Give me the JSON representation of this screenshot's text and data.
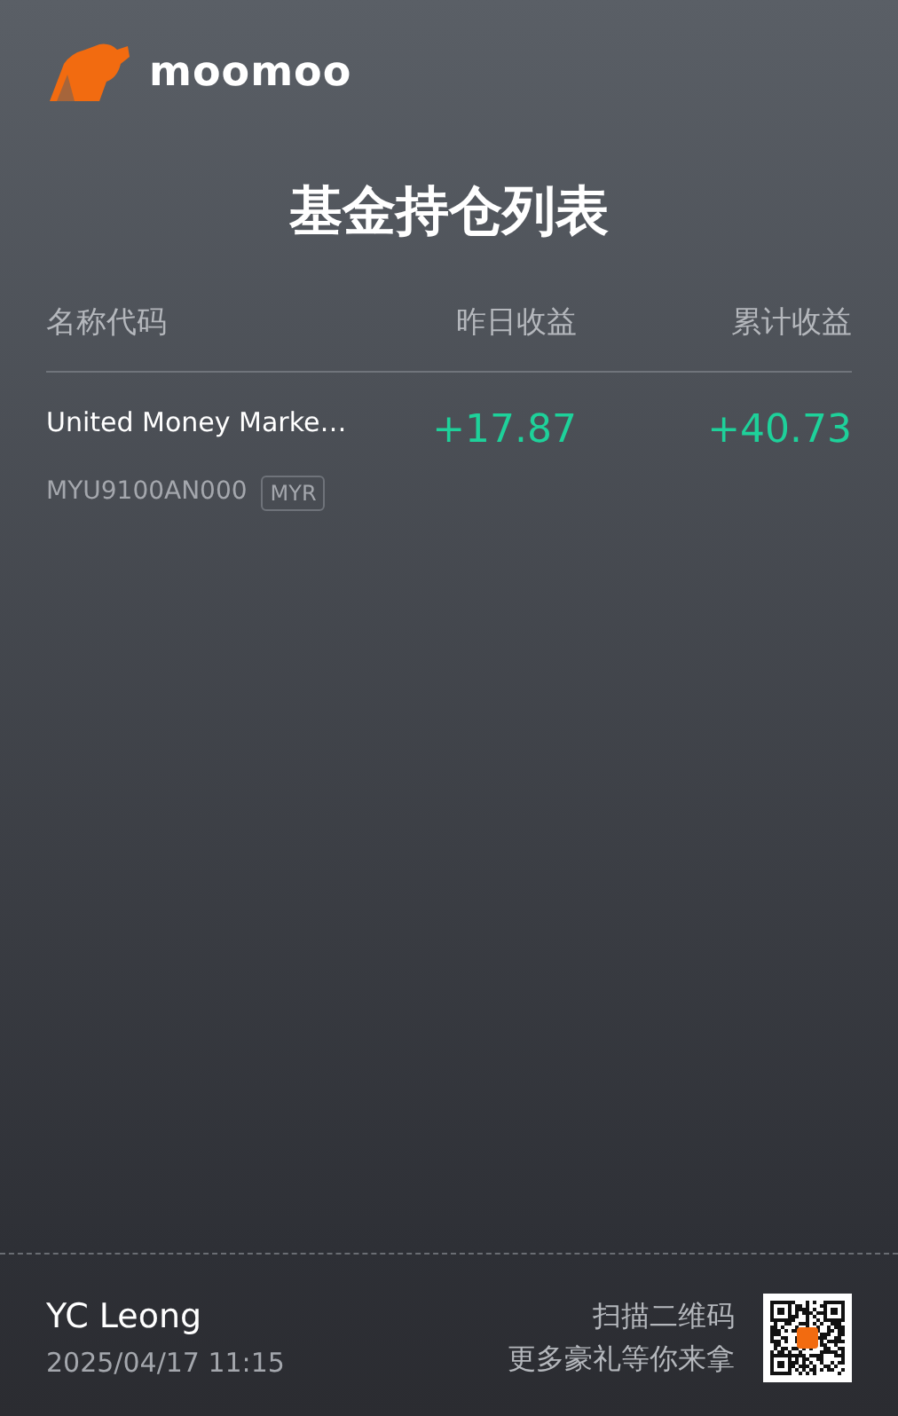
{
  "logo": {
    "text": "moomoo"
  },
  "title": "基金持仓列表",
  "table": {
    "columns": [
      "名称代码",
      "昨日收益",
      "累计收益"
    ],
    "rows": [
      {
        "name": "United Money Marke…",
        "code": "MYU9100AN000",
        "currency": "MYR",
        "yesterday": "+17.87",
        "total": "+40.73"
      }
    ]
  },
  "footer": {
    "user": "YC Leong",
    "datetime": "2025/04/17 11:15",
    "promo_lines": [
      "扫描二维码",
      "更多豪礼等你来拿"
    ]
  }
}
